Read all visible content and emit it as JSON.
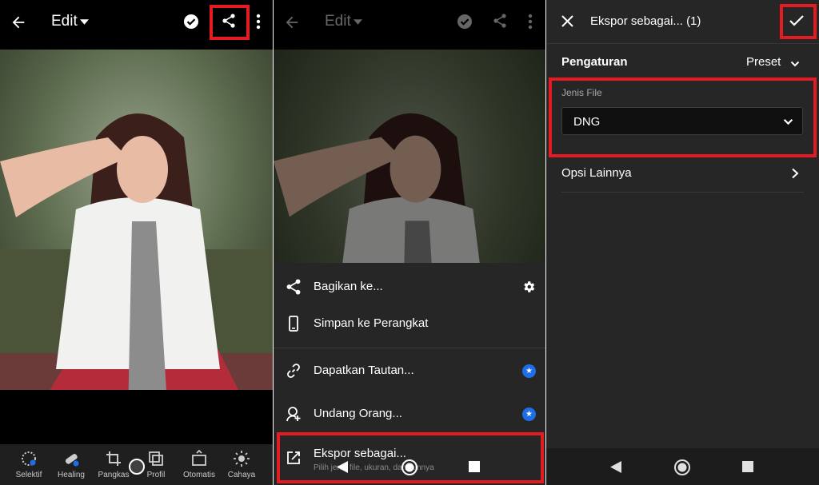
{
  "panel1": {
    "title": "Edit",
    "tools": [
      {
        "label": "Selektif",
        "icon": "selective-icon"
      },
      {
        "label": "Healing",
        "icon": "healing-icon"
      },
      {
        "label": "Pangkas",
        "icon": "crop-icon"
      },
      {
        "label": "Profil",
        "icon": "profile-icon"
      },
      {
        "label": "Otomatis",
        "icon": "auto-icon"
      },
      {
        "label": "Cahaya",
        "icon": "light-icon"
      }
    ]
  },
  "panel2": {
    "title": "Edit",
    "sheet": [
      {
        "label": "Bagikan ke...",
        "icon": "share-icon"
      },
      {
        "label": "Simpan ke Perangkat",
        "icon": "device-icon"
      },
      {
        "label": "Dapatkan Tautan...",
        "icon": "link-icon"
      },
      {
        "label": "Undang Orang...",
        "icon": "invite-icon"
      },
      {
        "label": "Ekspor sebagai...",
        "icon": "export-icon",
        "sub": "Pilih jenis file, ukuran, dan lainnya"
      }
    ]
  },
  "panel3": {
    "title": "Ekspor sebagai... (1)",
    "settings_label": "Pengaturan",
    "preset_label": "Preset",
    "file_type_label": "Jenis File",
    "file_type_value": "DNG",
    "more_options_label": "Opsi Lainnya"
  },
  "colors": {
    "highlight": "#e41c22",
    "accent_badge": "#1e6ee8"
  }
}
